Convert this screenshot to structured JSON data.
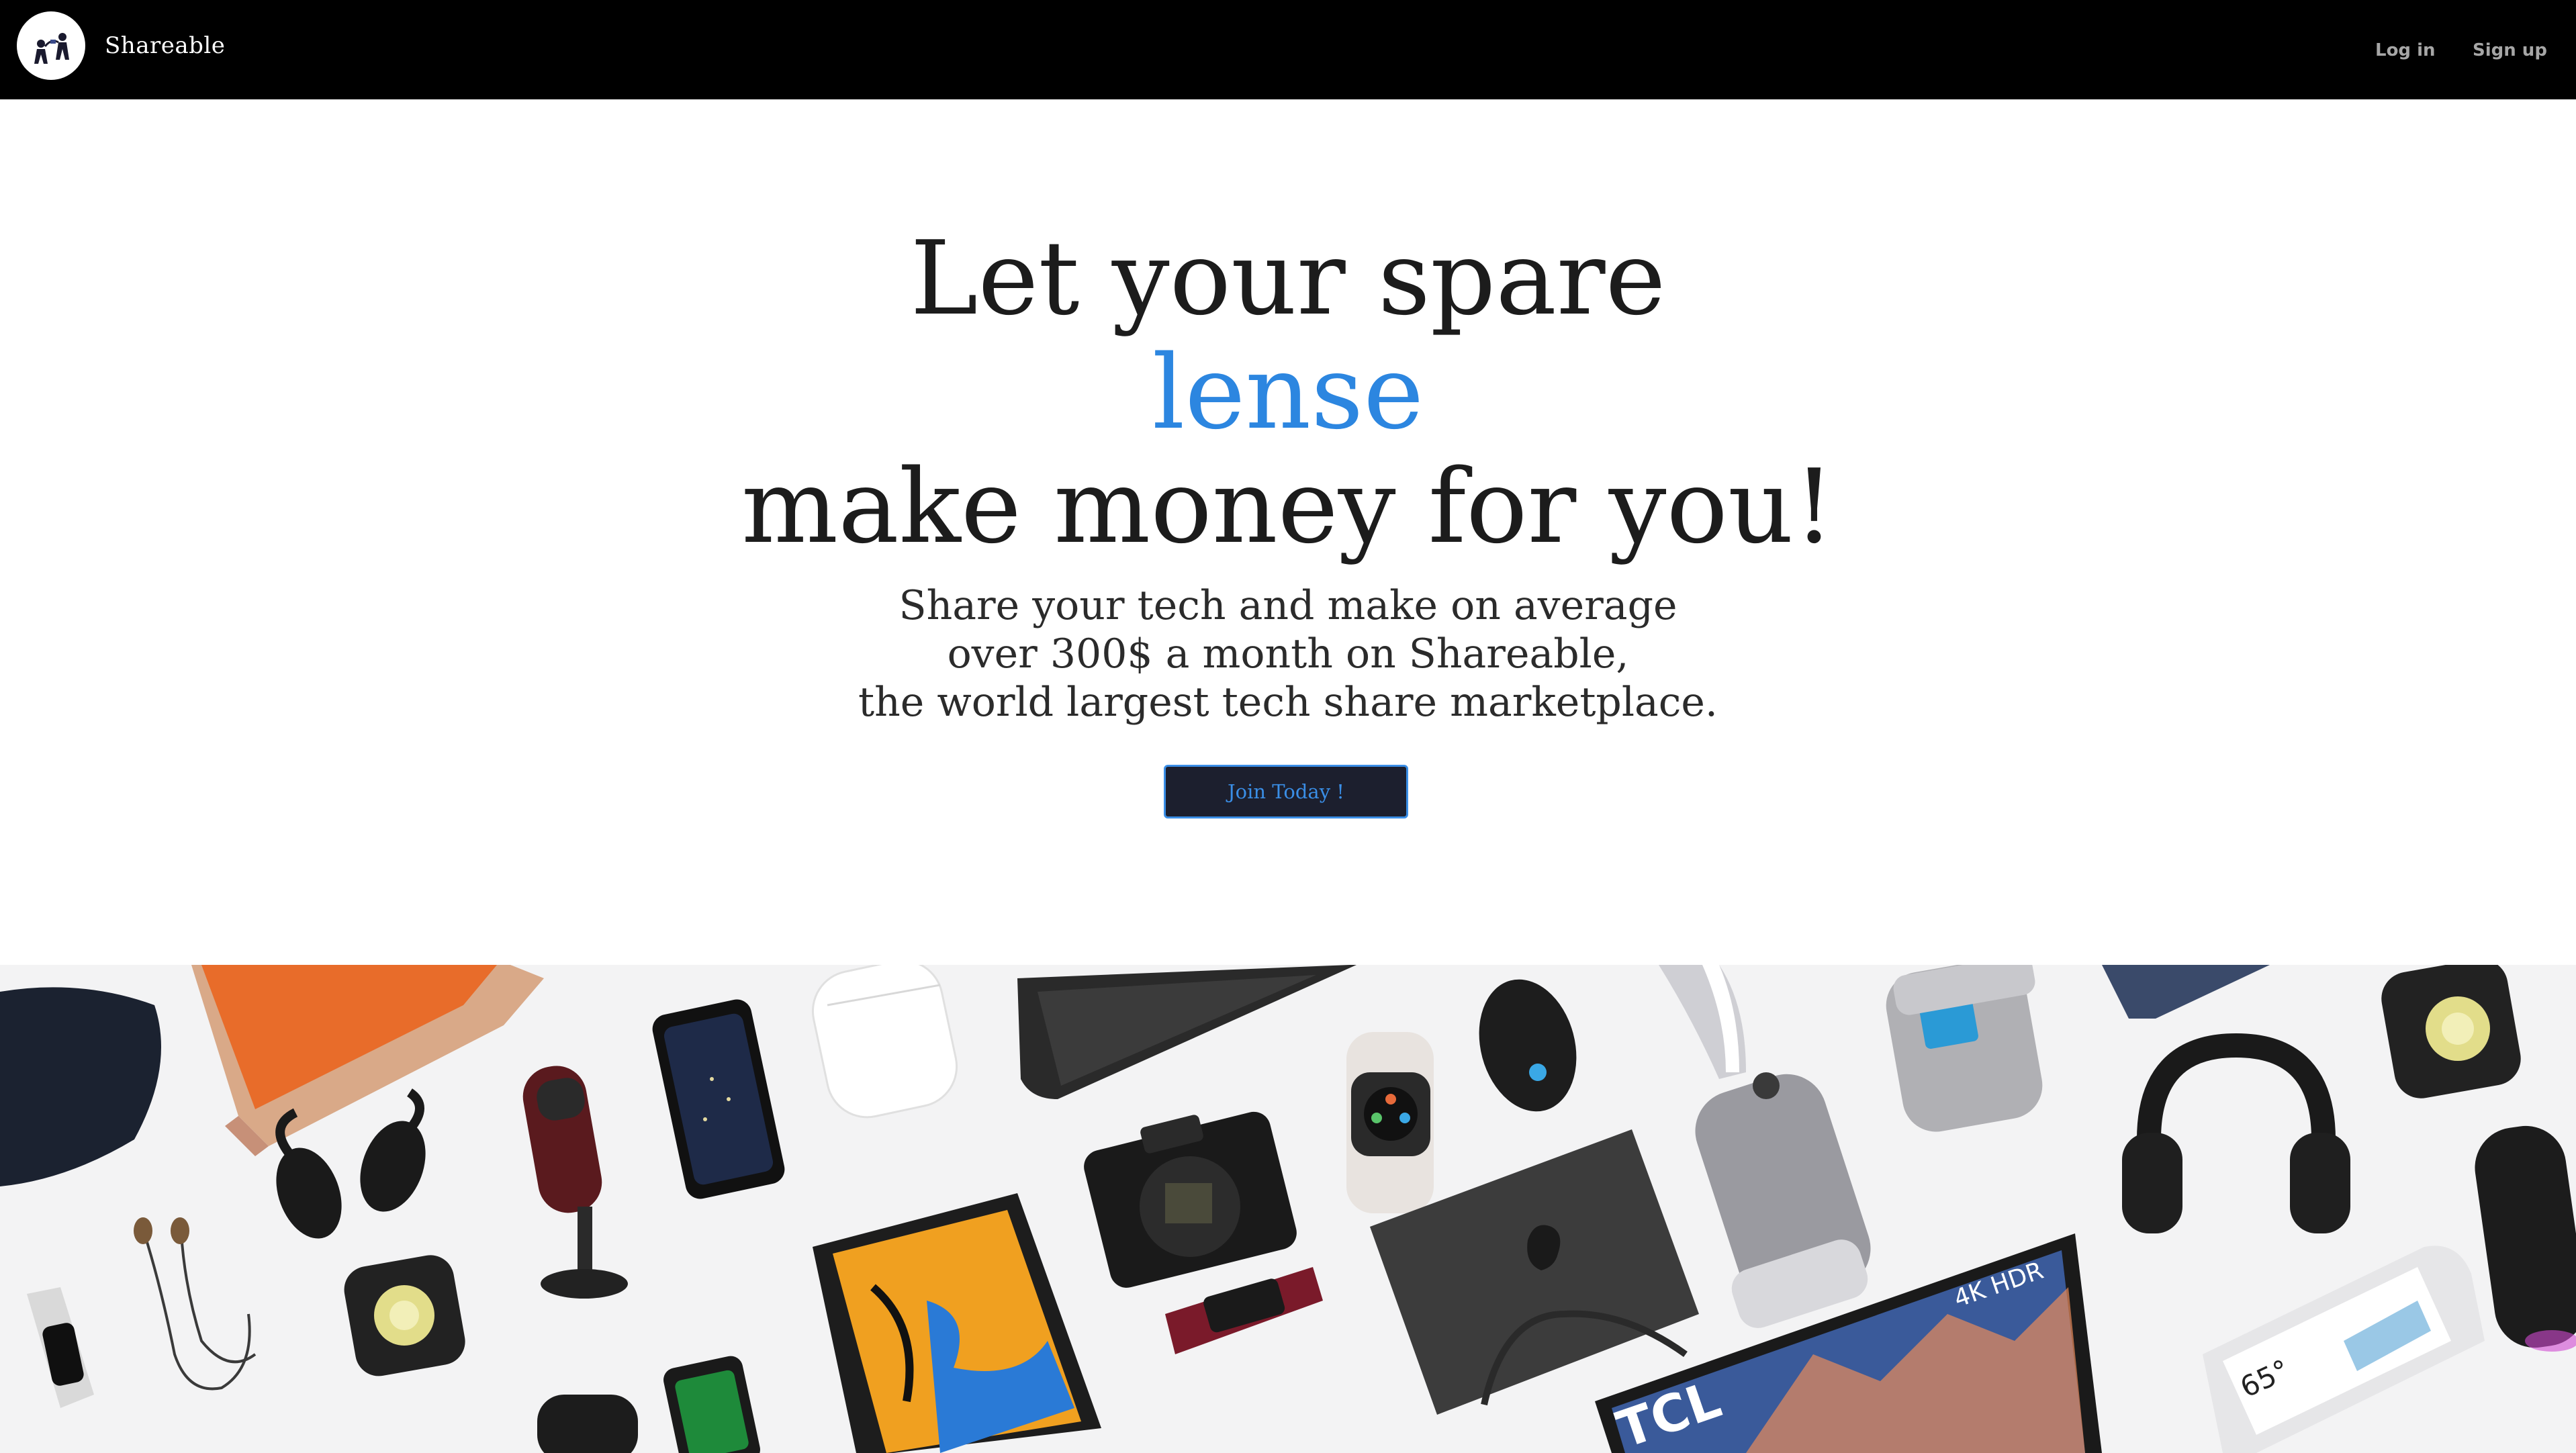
{
  "nav": {
    "brand_name": "Shareable",
    "login_label": "Log in",
    "signup_label": "Sign up"
  },
  "hero": {
    "title_line1": "Let your spare",
    "title_accent": "lense",
    "title_line3": "make money for you!",
    "subtitle_line1": "Share your tech and make on average",
    "subtitle_line2": "over 300$ a month on Shareable,",
    "subtitle_line3": "the world largest tech share marketplace.",
    "cta_label": "Join Today !"
  },
  "banner": {
    "tv_brand": "TCL",
    "tv_badge": "4K HDR",
    "display_temperature": "65°",
    "products": [
      "earbuds-case-icon",
      "laptop-icon",
      "earbuds-icon",
      "microphone-icon",
      "smartphone-icon",
      "airpods-icon",
      "keyboard-icon",
      "smartwatch-icon",
      "gaming-mouse-icon",
      "camera-icon",
      "tablet-icon",
      "fitness-band-icon",
      "macbook-icon",
      "air-purifier-icon",
      "smart-speaker-icon",
      "headphones-icon",
      "tv-icon",
      "smart-display-icon",
      "cylinder-speaker-icon",
      "wired-earphones-icon",
      "fitness-tracker-icon",
      "cube-speaker-icon"
    ]
  },
  "colors": {
    "nav_bg": "#000000",
    "accent": "#2c86e0",
    "cta_bg": "#1c1f2e",
    "banner_bg": "#f3f3f4"
  }
}
